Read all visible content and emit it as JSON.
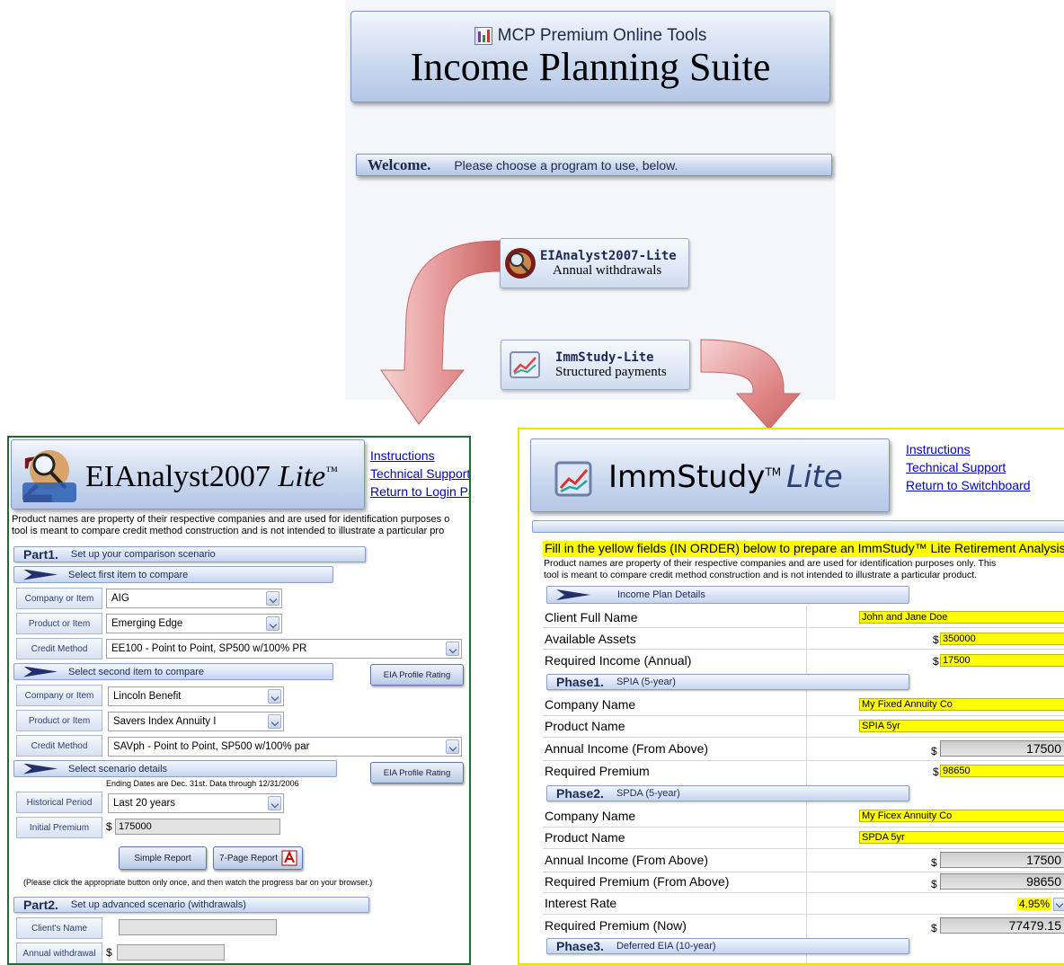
{
  "switchboard": {
    "subtitle": "MCP Premium Online Tools",
    "title": "Income Planning Suite",
    "welcome_label": "Welcome.",
    "welcome_text": "Please choose a program to use, below.",
    "programs": [
      {
        "name": "EIAnalyst2007-Lite",
        "desc": "Annual withdrawals"
      },
      {
        "name": "ImmStudy-Lite",
        "desc": "Structured payments"
      }
    ]
  },
  "eia": {
    "title_main": "EIAnalyst2007",
    "title_em": "Lite",
    "title_tm": "™",
    "links": [
      "Instructions",
      "Technical Support",
      "Return to Login Pa"
    ],
    "disclaimer1": "Product names are property of their respective companies and are used for identification purposes o",
    "disclaimer2": "tool is meant to compare credit method construction and is not intended to illustrate a particular pro",
    "part1_num": "Part1.",
    "part1_text": "Set up your comparison scenario",
    "sec1": "Select first item to compare",
    "sec2": "Select second item to compare",
    "sec3": "Select scenario details",
    "labels": {
      "company": "Company or Item",
      "product": "Product or Item",
      "credit": "Credit Method",
      "historical": "Historical Period",
      "premium": "Initial Premium",
      "client": "Client's Name",
      "withdrawal": "Annual withdrawal"
    },
    "item1": {
      "company": "AIG",
      "product": "Emerging Edge",
      "credit": "EE100 - Point to Point, SP500 w/100% PR"
    },
    "item2": {
      "company": "Lincoln Benefit",
      "product": "Savers Index Annuity I",
      "credit": "SAVph - Point to Point, SP500 w/100% par"
    },
    "eia_profile_btn": "EIA Profile Rating",
    "ending_note": "Ending Dates are Dec. 31st. Data through 12/31/2006",
    "historical_period": "Last 20 years",
    "currency": "$",
    "initial_premium": "175000",
    "simple_report": "Simple Report",
    "seven_page_report": "7-Page Report",
    "click_note": "(Please click the appropriate button only once, and then watch the progress bar on your browser.)",
    "part2_num": "Part2.",
    "part2_text": "Set up advanced scenario (withdrawals)",
    "client_name": "",
    "annual_withdrawal": ""
  },
  "imm": {
    "title_main": "ImmStudy",
    "title_tm": "TM",
    "title_em": "Lite",
    "links": [
      "Instructions",
      "Technical Support",
      "Return to Switchboard"
    ],
    "yellow_head": "Fill in the yellow fields (IN ORDER) below to prepare an ImmStudy™ Lite Retirement Analysis",
    "disclaimer1": "Product names are property of their respective companies and are used for identification purposes only. This",
    "disclaimer2": "tool is meant to compare credit method construction and is not intended to illustrate a particular product.",
    "income_details": "Income Plan Details",
    "currency": "$",
    "client_label": "Client Full Name",
    "client_value": "John and Jane Doe",
    "assets_label": "Available Assets",
    "assets_value": "350000",
    "req_income_label": "Required Income (Annual)",
    "req_income_value": "17500",
    "phase1_num": "Phase1.",
    "phase1_text": "SPIA (5-year)",
    "p1_company_label": "Company Name",
    "p1_company_value": "My Fixed Annuity Co",
    "p1_product_label": "Product Name",
    "p1_product_value": "SPIA 5yr",
    "p1_income_label": "Annual Income (From Above)",
    "p1_income_value": "17500",
    "p1_premium_label": "Required Premium",
    "p1_premium_value": "98650",
    "phase2_num": "Phase2.",
    "phase2_text": "SPDA (5-year)",
    "p2_company_label": "Company Name",
    "p2_company_value": "My Ficex Annuity Co",
    "p2_product_label": "Product Name",
    "p2_product_value": "SPDA 5yr",
    "p2_income_label": "Annual Income (From Above)",
    "p2_income_value": "17500",
    "p2_premium_above_label": "Required Premium (From Above)",
    "p2_premium_above_value": "98650",
    "p2_rate_label": "Interest Rate",
    "p2_rate_value": "4.95%",
    "p2_premium_now_label": "Required Premium (Now)",
    "p2_premium_now_value": "77479.15",
    "phase3_num": "Phase3.",
    "phase3_text": "Deferred EIA (10-year)"
  },
  "colors": {
    "banner_light": "#f2f6fd",
    "banner_dark": "#b4c7e6",
    "arrow": "#d98080",
    "yellow": "#ffff00",
    "left_border": "#1f6b33",
    "right_border": "#e6e600",
    "link": "#0000cc"
  }
}
